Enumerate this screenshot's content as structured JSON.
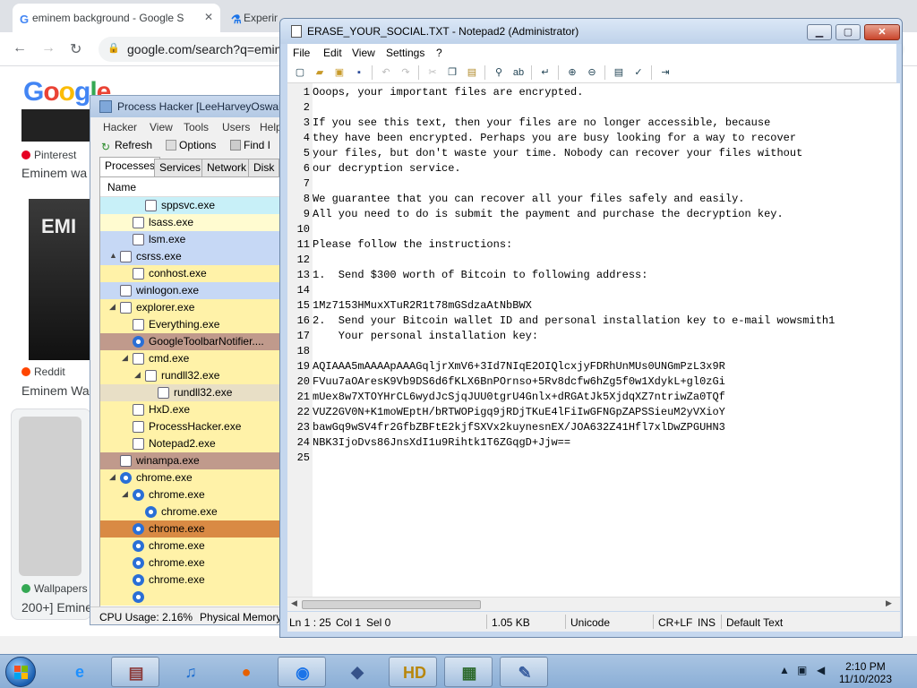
{
  "chrome": {
    "tabs": [
      {
        "label": "eminem background - Google S",
        "favicon": "G"
      },
      {
        "label": "Experiments",
        "favicon": "flask"
      }
    ],
    "url": "google.com/search?q=emin",
    "logo": "Google",
    "results": [
      {
        "source": "Pinterest",
        "title": "Eminem wa"
      },
      {
        "source": "Reddit",
        "title": "Eminem Wa"
      },
      {
        "source": "Wallpapers",
        "title": "200+] Emine"
      }
    ],
    "thumb_text": "EMI"
  },
  "process_hacker": {
    "title": "Process Hacker [LeeHarveyOswald",
    "menu": [
      "Hacker",
      "View",
      "Tools",
      "Users",
      "Help"
    ],
    "toolbar": {
      "refresh": "Refresh",
      "options": "Options",
      "find": "Find I"
    },
    "tabs": [
      "Processes",
      "Services",
      "Network",
      "Disk"
    ],
    "column_name": "Name",
    "processes": [
      {
        "name": "sppsvc.exe",
        "indent": 3,
        "color": "#c8f0f8",
        "icon": "box",
        "expand": ""
      },
      {
        "name": "lsass.exe",
        "indent": 2,
        "color": "#fffbd0",
        "icon": "box",
        "expand": ""
      },
      {
        "name": "lsm.exe",
        "indent": 2,
        "color": "#c6d8f5",
        "icon": "box",
        "expand": ""
      },
      {
        "name": "csrss.exe",
        "indent": 1,
        "color": "#c6d8f5",
        "icon": "box",
        "expand": "▲"
      },
      {
        "name": "conhost.exe",
        "indent": 2,
        "color": "#fff2a8",
        "icon": "box",
        "expand": ""
      },
      {
        "name": "winlogon.exe",
        "indent": 1,
        "color": "#c6d8f5",
        "icon": "box",
        "expand": ""
      },
      {
        "name": "explorer.exe",
        "indent": 1,
        "color": "#fff2a8",
        "icon": "box",
        "expand": "◢"
      },
      {
        "name": "Everything.exe",
        "indent": 2,
        "color": "#fff2a8",
        "icon": "box",
        "expand": ""
      },
      {
        "name": "GoogleToolbarNotifier....",
        "indent": 2,
        "color": "#c09a8c",
        "icon": "round",
        "expand": ""
      },
      {
        "name": "cmd.exe",
        "indent": 2,
        "color": "#fff2a8",
        "icon": "box",
        "expand": "◢"
      },
      {
        "name": "rundll32.exe",
        "indent": 3,
        "color": "#fff2a8",
        "icon": "box",
        "expand": "◢"
      },
      {
        "name": "rundll32.exe",
        "indent": 4,
        "color": "#e8dfc6",
        "icon": "box",
        "expand": ""
      },
      {
        "name": "HxD.exe",
        "indent": 2,
        "color": "#fff2a8",
        "icon": "box",
        "expand": ""
      },
      {
        "name": "ProcessHacker.exe",
        "indent": 2,
        "color": "#fff2a8",
        "icon": "box",
        "expand": ""
      },
      {
        "name": "Notepad2.exe",
        "indent": 2,
        "color": "#fff2a8",
        "icon": "box",
        "expand": ""
      },
      {
        "name": "winampa.exe",
        "indent": 1,
        "color": "#c09a8c",
        "icon": "box",
        "expand": ""
      },
      {
        "name": "chrome.exe",
        "indent": 1,
        "color": "#fff2a8",
        "icon": "round",
        "expand": "◢"
      },
      {
        "name": "chrome.exe",
        "indent": 2,
        "color": "#fff2a8",
        "icon": "round",
        "expand": "◢"
      },
      {
        "name": "chrome.exe",
        "indent": 3,
        "color": "#fff2a8",
        "icon": "round",
        "expand": ""
      },
      {
        "name": "chrome.exe",
        "indent": 2,
        "color": "#d98a44",
        "icon": "round",
        "expand": ""
      },
      {
        "name": "chrome.exe",
        "indent": 2,
        "color": "#fff2a8",
        "icon": "round",
        "expand": ""
      },
      {
        "name": "chrome.exe",
        "indent": 2,
        "color": "#fff2a8",
        "icon": "round",
        "expand": ""
      },
      {
        "name": "chrome.exe",
        "indent": 2,
        "color": "#fff2a8",
        "icon": "round",
        "expand": ""
      },
      {
        "name": "",
        "indent": 2,
        "color": "#fff2a8",
        "icon": "round",
        "expand": ""
      }
    ],
    "status": {
      "cpu": "CPU Usage: 2.16%",
      "memory": "Physical Memory"
    }
  },
  "notepad": {
    "title": "ERASE_YOUR_SOCIAL.TXT - Notepad2 (Administrator)",
    "menu": [
      "File",
      "Edit",
      "View",
      "Settings",
      "?"
    ],
    "lines": [
      "Ooops, your important files are encrypted.",
      "",
      "If you see this text, then your files are no longer accessible, because",
      "they have been encrypted. Perhaps you are busy looking for a way to recover",
      "your files, but don't waste your time. Nobody can recover your files without",
      "our decryption service.",
      "",
      "We guarantee that you can recover all your files safely and easily.",
      "All you need to do is submit the payment and purchase the decryption key.",
      "",
      "Please follow the instructions:",
      "",
      "1.  Send $300 worth of Bitcoin to following address:",
      "",
      "1Mz7153HMuxXTuR2R1t78mGSdzaAtNbBWX",
      "2.  Send your Bitcoin wallet ID and personal installation key to e-mail wowsmith1",
      "    Your personal installation key:",
      "",
      "AQIAAA5mAAAApAAAGqljrXmV6+3Id7NIqE2OIQlcxjyFDRhUnMUs0UNGmPzL3x9R",
      "FVuu7aOAresK9Vb9DS6d6fKLX6BnPOrnso+5Rv8dcfw6hZg5f0w1XdykL+gl0zGi",
      "mUex8w7XTOYHrCL6wydJcSjqJUU0tgrU4Gnlx+dRGAtJk5XjdqXZ7ntriwZa0TQf",
      "VUZ2GV0N+K1moWEptH/bRTWOPigq9jRDjTKuE4lFiIwGFNGpZAPSSieuM2yVXioY",
      "bawGq9wSV4fr2GfbZBFtE2kjfSXVx2kuynesnEX/JOA632Z41Hfl7xlDwZPGUHN3",
      "NBK3IjoDvs86JnsXdI1u9Rihtk1T6ZGqgD+Jjw==",
      ""
    ],
    "status": {
      "position": "Ln 1 : 25",
      "column": "Col 1",
      "selection": "Sel 0",
      "size": "1.05 KB",
      "encoding": "Unicode",
      "eol": "CR+LF",
      "ins": "INS",
      "scheme": "Default Text"
    }
  },
  "taskbar": {
    "apps": [
      {
        "name": "ie",
        "glyph": "e",
        "color": "#1e90ff",
        "running": false
      },
      {
        "name": "archive",
        "glyph": "▤",
        "color": "#8b3a3a",
        "running": true
      },
      {
        "name": "music",
        "glyph": "♫",
        "color": "#1f6fd0",
        "running": false
      },
      {
        "name": "firefox",
        "glyph": "●",
        "color": "#e66000",
        "running": false
      },
      {
        "name": "chrome",
        "glyph": "◉",
        "color": "#1a73e8",
        "running": true
      },
      {
        "name": "install",
        "glyph": "◆",
        "color": "#36538a",
        "running": false
      },
      {
        "name": "hxd",
        "glyph": "HD",
        "color": "#b8860b",
        "running": true
      },
      {
        "name": "processhacker",
        "glyph": "▦",
        "color": "#2e6b2e",
        "running": true
      },
      {
        "name": "notepad2",
        "glyph": "✎",
        "color": "#3a5fa0",
        "running": true
      }
    ],
    "time": "2:10 PM",
    "date": "11/10/2023"
  }
}
